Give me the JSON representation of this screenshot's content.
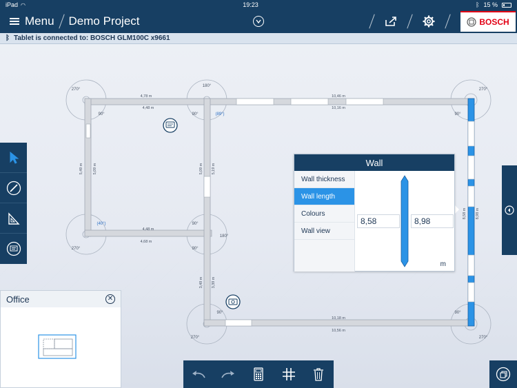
{
  "status": {
    "device": "iPad",
    "time": "19:23",
    "battery": "15 %"
  },
  "nav": {
    "menu_label": "Menu",
    "project_title": "Demo Project"
  },
  "brand": {
    "name": "BOSCH",
    "color": "#e20015"
  },
  "connection": {
    "text": "Tablet is connected to: BOSCH GLM100C x9661"
  },
  "colors": {
    "navy": "#173f63",
    "accent": "#2b93e6",
    "wall": "#d5d8dd"
  },
  "plan": {
    "dimensions": {
      "top_left_outer": "4,78 m",
      "top_left_inner": "4,48 m",
      "top_right_outer": "10,46 m",
      "top_right_inner": "10,16 m",
      "bottom_left_inner": "4,48 m",
      "bottom_left_outer": "4,68 m",
      "bottom_right_inner": "10,18 m",
      "bottom_right_outer": "10,56 m",
      "left_outer": "5,49 m",
      "left_inner": "5,09 m",
      "middle_a": "5,09 m",
      "middle_b": "5,19 m",
      "lower_a": "3,49 m",
      "lower_b": "3,39 m",
      "right_inner": "8,58 m",
      "right_outer": "8,98 m"
    },
    "angles": {
      "a1": "270°",
      "a2": "90°",
      "a3": "180°",
      "a4": "90°",
      "a5": "(89°)",
      "a6": "270°",
      "a7": "90°",
      "a8": "(40°)",
      "a9": "270°",
      "a10": "90°",
      "a11": "180°",
      "a12": "90°",
      "a13": "90°",
      "a14": "270°",
      "a15": "90°",
      "a16": "270°"
    }
  },
  "wall_panel": {
    "title": "Wall",
    "options": [
      "Wall thickness",
      "Wall length",
      "Colours",
      "Wall view"
    ],
    "active_option": "Wall length",
    "value_inner": "8,58",
    "value_outer": "8,98",
    "unit": "m"
  },
  "office": {
    "title": "Office"
  },
  "icons": {
    "left_tools": [
      "pointer-icon",
      "pencil-icon",
      "measure-icon",
      "comment-icon"
    ],
    "bottom_tools": [
      "undo-icon",
      "redo-icon",
      "calculator-icon",
      "grid-icon",
      "trash-icon"
    ]
  }
}
